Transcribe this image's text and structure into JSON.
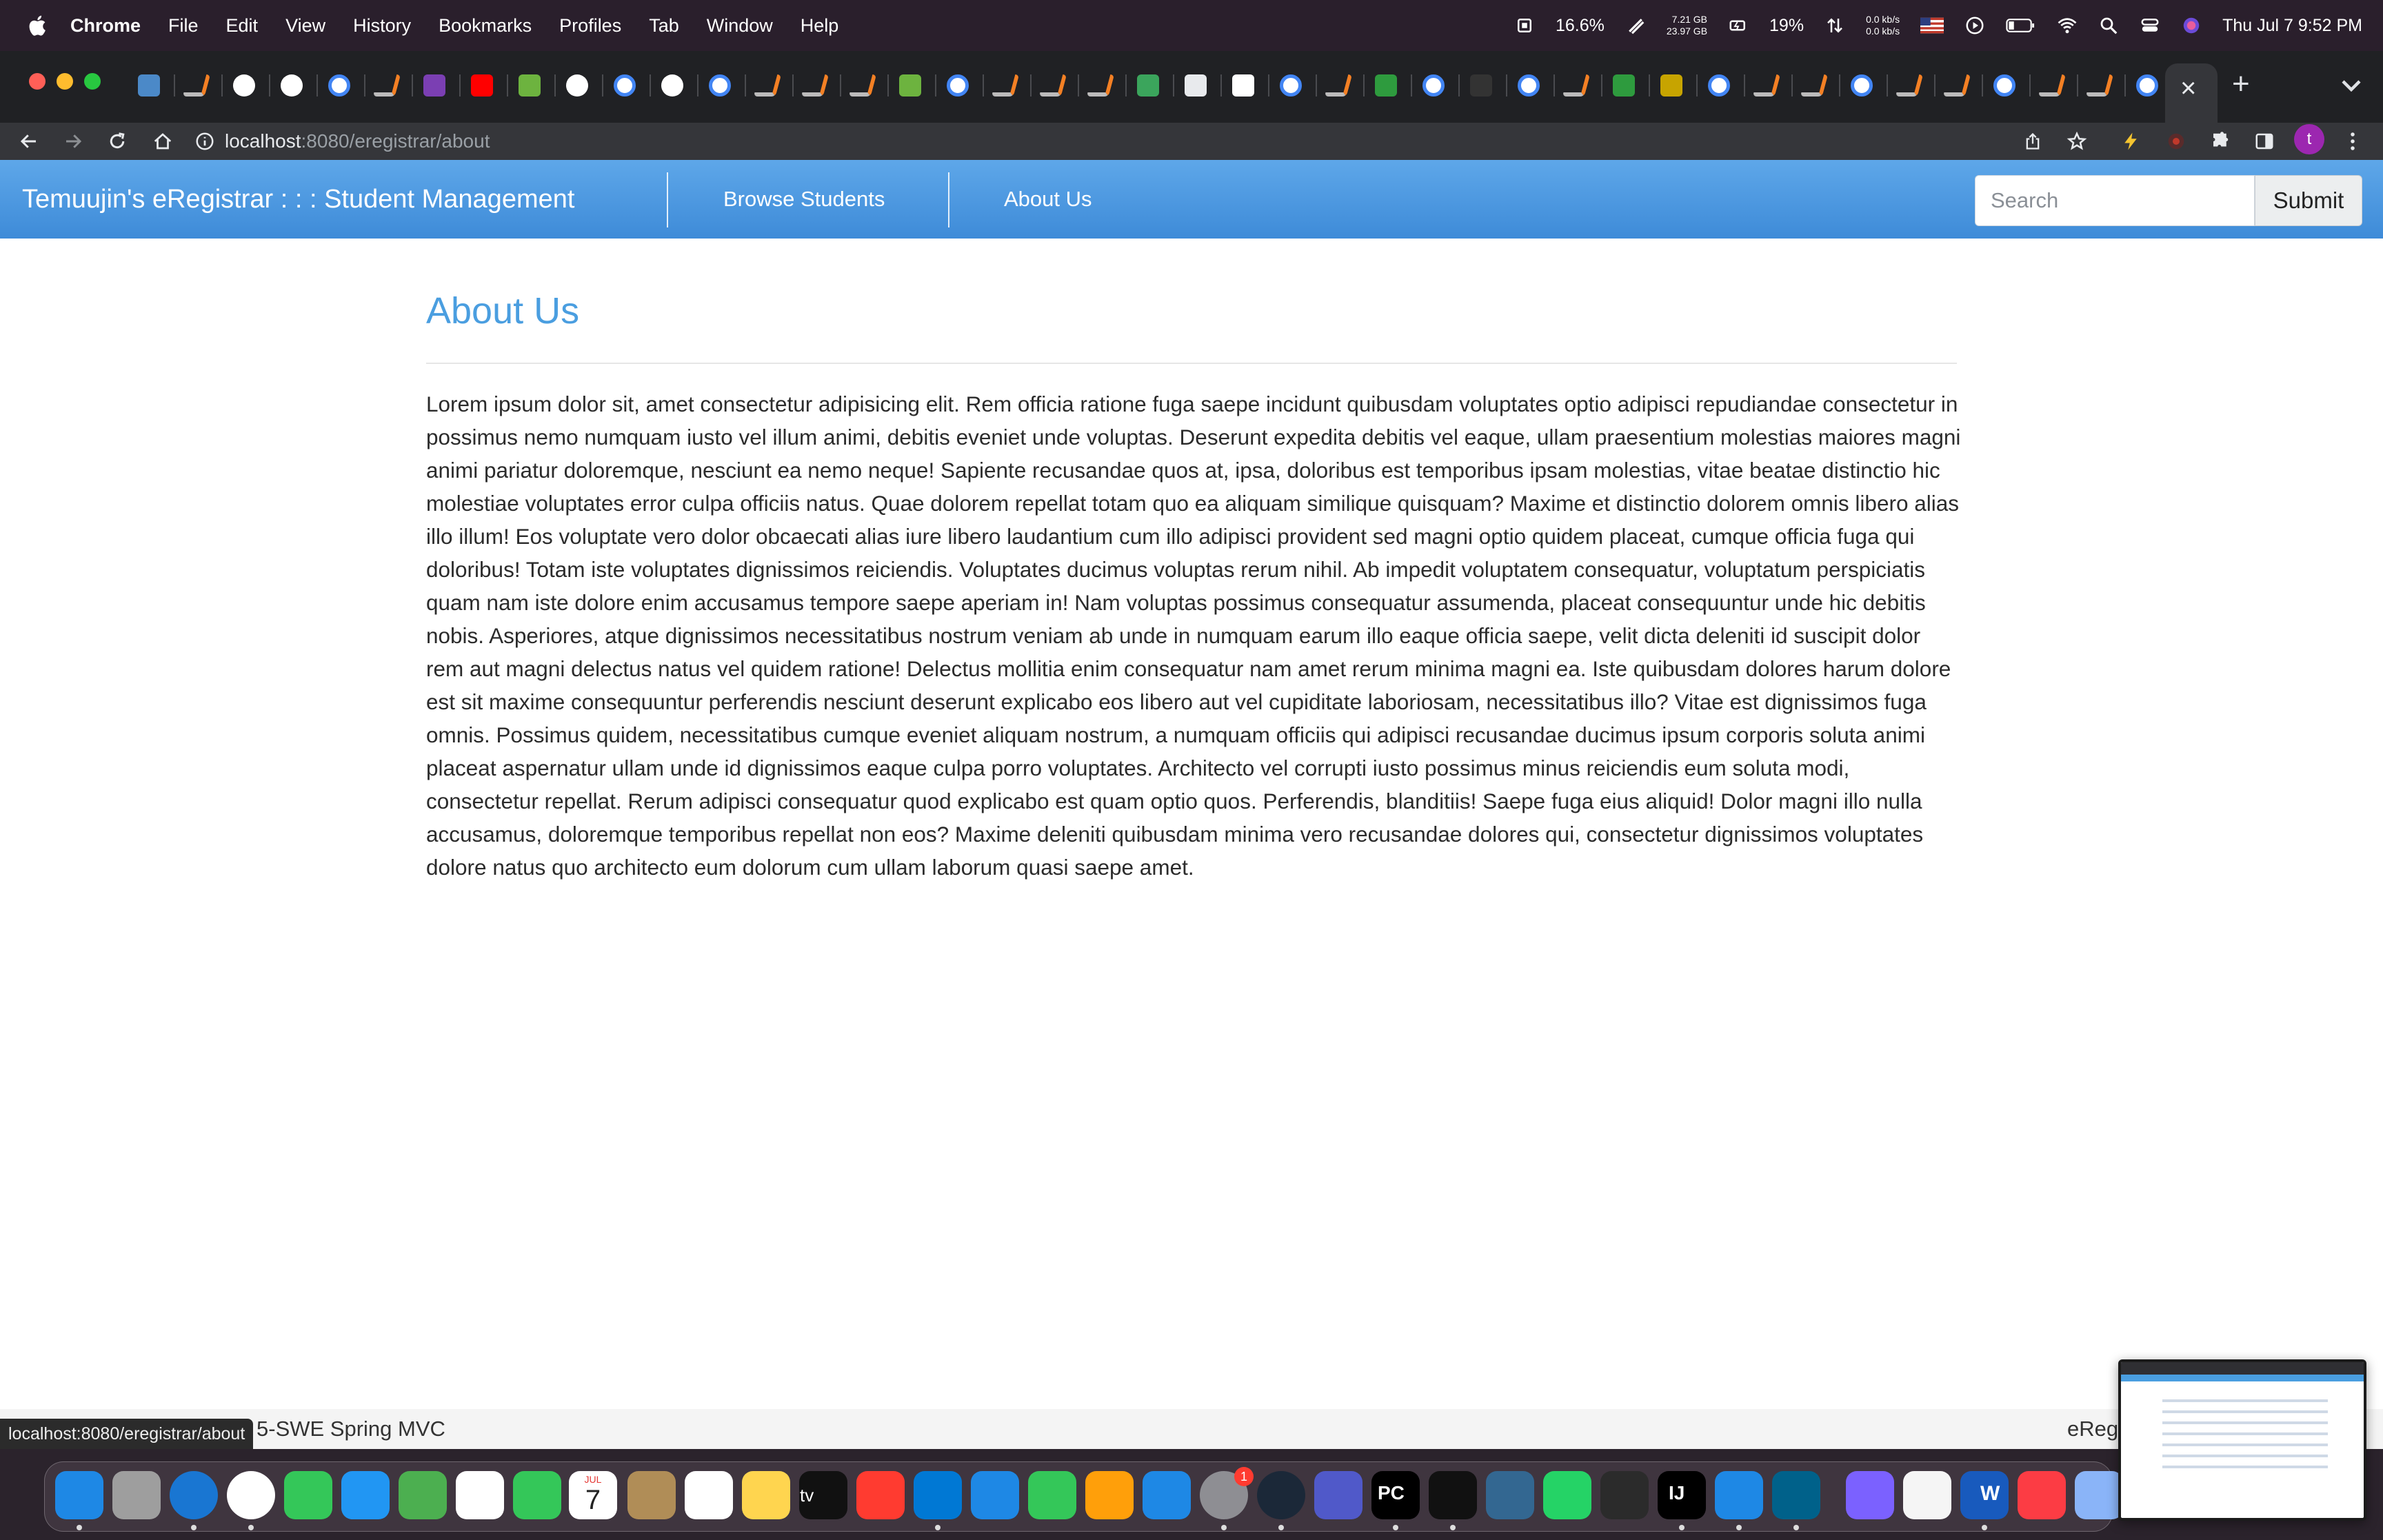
{
  "menubar": {
    "app_name": "Chrome",
    "items": [
      "File",
      "Edit",
      "View",
      "History",
      "Bookmarks",
      "Profiles",
      "Tab",
      "Window",
      "Help"
    ],
    "cpu": "16.6%",
    "mem_top": "7.21 GB",
    "mem_bottom": "23.97 GB",
    "battery": "19%",
    "net_up": "0.0 kb/s",
    "net_down": "0.0 kb/s",
    "datetime": "Thu Jul 7  9:52 PM"
  },
  "browser": {
    "url_host": "localhost",
    "url_path": ":8080/eregistrar/about",
    "profile_initial": "t",
    "new_tab_glyph": "+",
    "close_tab_glyph": "×"
  },
  "site": {
    "brand": "Temuujin's eRegistrar : : : Student Management",
    "nav": [
      "Browse Students",
      "About Us"
    ],
    "search_placeholder": "Search",
    "submit_label": "Submit"
  },
  "content": {
    "title": "About Us",
    "body": "Lorem ipsum dolor sit, amet consectetur adipisicing elit. Rem officia ratione fuga saepe incidunt quibusdam voluptates optio adipisci repudiandae consectetur in possimus nemo numquam iusto vel illum animi, debitis eveniet unde voluptas. Deserunt expedita debitis vel eaque, ullam praesentium molestias maiores magni animi pariatur doloremque, nesciunt ea nemo neque! Sapiente recusandae quos at, ipsa, doloribus est temporibus ipsam molestias, vitae beatae distinctio hic molestiae voluptates error culpa officiis natus. Quae dolorem repellat totam quo ea aliquam similique quisquam? Maxime et distinctio dolorem omnis libero alias illo illum! Eos voluptate vero dolor obcaecati alias iure libero laudantium cum illo adipisci provident sed magni optio quidem placeat, cumque officia fuga qui doloribus! Totam iste voluptates dignissimos reiciendis. Voluptates ducimus voluptas rerum nihil. Ab impedit voluptatem consequatur, voluptatum perspiciatis quam nam iste dolore enim accusamus tempore saepe aperiam in! Nam voluptas possimus consequatur assumenda, placeat consequuntur unde hic debitis nobis. Asperiores, atque dignissimos necessitatibus nostrum veniam ab unde in numquam earum illo eaque officia saepe, velit dicta deleniti id suscipit dolor rem aut magni delectus natus vel quidem ratione! Delectus mollitia enim consequatur nam amet rerum minima magni ea. Iste quibusdam dolores harum dolore est sit maxime consequuntur perferendis nesciunt deserunt explicabo eos libero aut vel cupiditate laboriosam, necessitatibus illo? Vitae est dignissimos fuga omnis. Possimus quidem, necessitatibus cumque eveniet aliquam nostrum, a numquam officiis qui adipisci recusandae ducimus ipsum corporis soluta animi placeat aspernatur ullam unde id dignissimos eaque culpa porro voluptates. Architecto vel corrupti iusto possimus minus reiciendis eum soluta modi, consectetur repellat. Rerum adipisci consequatur quod explicabo est quam optio quos. Perferendis, blanditiis! Saepe fuga eius aliquid! Dolor magni illo nulla accusamus, doloremque temporibus repellat non eos? Maxime deleniti quibusdam minima vero recusandae dolores qui, consectetur dignissimos voluptates dolore natus quo architecto eum dolorum cum ullam laborum quasi saepe amet."
  },
  "footer": {
    "left": "5-SWE Spring MVC",
    "right": "eReg"
  },
  "status_url": "localhost:8080/eregistrar/about",
  "dock": {
    "calendar_month": "JUL",
    "calendar_day": "7",
    "settings_badge": "1",
    "appletv_label": "tv",
    "pycharm_label": "PC",
    "intellij_label": "IJ",
    "word_label": "W"
  }
}
